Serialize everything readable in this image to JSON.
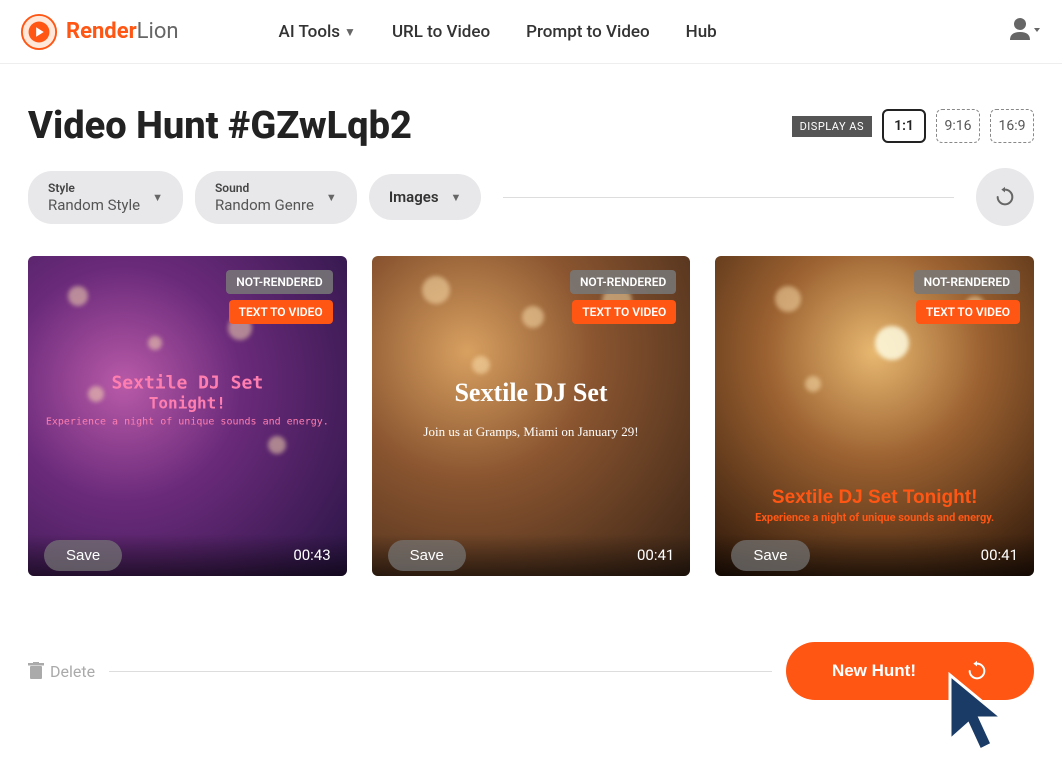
{
  "brand": {
    "name1": "Render",
    "name2": "Lion"
  },
  "nav": {
    "ai_tools": "AI Tools",
    "url_to_video": "URL to Video",
    "prompt_to_video": "Prompt to Video",
    "hub": "Hub"
  },
  "page": {
    "title": "Video Hunt #GZwLqb2",
    "display_as_label": "DISPLAY AS",
    "ratios": {
      "r1": "1:1",
      "r2": "9:16",
      "r3": "16:9"
    }
  },
  "filters": {
    "style": {
      "label": "Style",
      "value": "Random Style"
    },
    "sound": {
      "label": "Sound",
      "value": "Random Genre"
    },
    "images": {
      "label": "Images"
    }
  },
  "badges": {
    "not_rendered": "NOT-RENDERED",
    "text_to_video": "TEXT TO VIDEO"
  },
  "cards": [
    {
      "save": "Save",
      "duration": "00:43",
      "title_line1": "Sextile DJ Set",
      "title_line2": "Tonight!",
      "subtitle": "Experience a night of unique sounds and energy."
    },
    {
      "save": "Save",
      "duration": "00:41",
      "title": "Sextile DJ Set",
      "subtitle": "Join us at Gramps, Miami on January 29!"
    },
    {
      "save": "Save",
      "duration": "00:41",
      "title": "Sextile DJ Set Tonight!",
      "subtitle": "Experience a night of unique sounds and energy."
    }
  ],
  "bottom": {
    "delete": "Delete",
    "new_hunt": "New Hunt!"
  }
}
